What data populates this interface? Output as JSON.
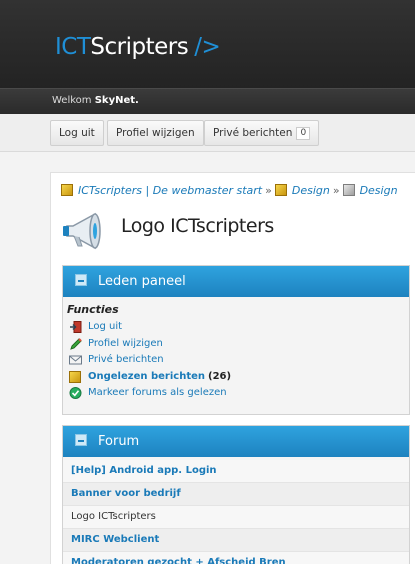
{
  "header": {
    "logo_ict": "ICT",
    "logo_scripters": "Scripters",
    "logo_tag": "/>"
  },
  "welcome": {
    "prefix": "Welkom",
    "user": "SkyNet."
  },
  "userbar": {
    "logout": "Log uit",
    "profile": "Profiel wijzigen",
    "pm": "Privé berichten",
    "pm_count": "0"
  },
  "breadcrumb": {
    "items": [
      "ICTscripters | De webmaster start",
      "Design",
      "Design"
    ],
    "separator": "»"
  },
  "page_title": "Logo ICTscripters",
  "leden": {
    "title": "Leden paneel",
    "functions_heading": "Functies",
    "items": [
      {
        "label": "Log uit",
        "icon": "logout-icon"
      },
      {
        "label": "Profiel wijzigen",
        "icon": "pencil-icon"
      },
      {
        "label": "Privé berichten",
        "icon": "envelope-icon"
      },
      {
        "label": "Ongelezen berichten",
        "count": "(26)",
        "icon": "cube-icon"
      },
      {
        "label": "Markeer forums als gelezen",
        "icon": "check-icon"
      }
    ]
  },
  "forum": {
    "title": "Forum",
    "rows": [
      "[Help] Android app. Login",
      "Banner voor bedrijf",
      "Logo ICTscripters",
      "MIRC Webclient",
      "Moderatoren gezocht + Afscheid Bren"
    ]
  },
  "colors": {
    "accent": "#1f8fd6",
    "panel_header": "#2a97d4",
    "link": "#1a7ab8"
  }
}
